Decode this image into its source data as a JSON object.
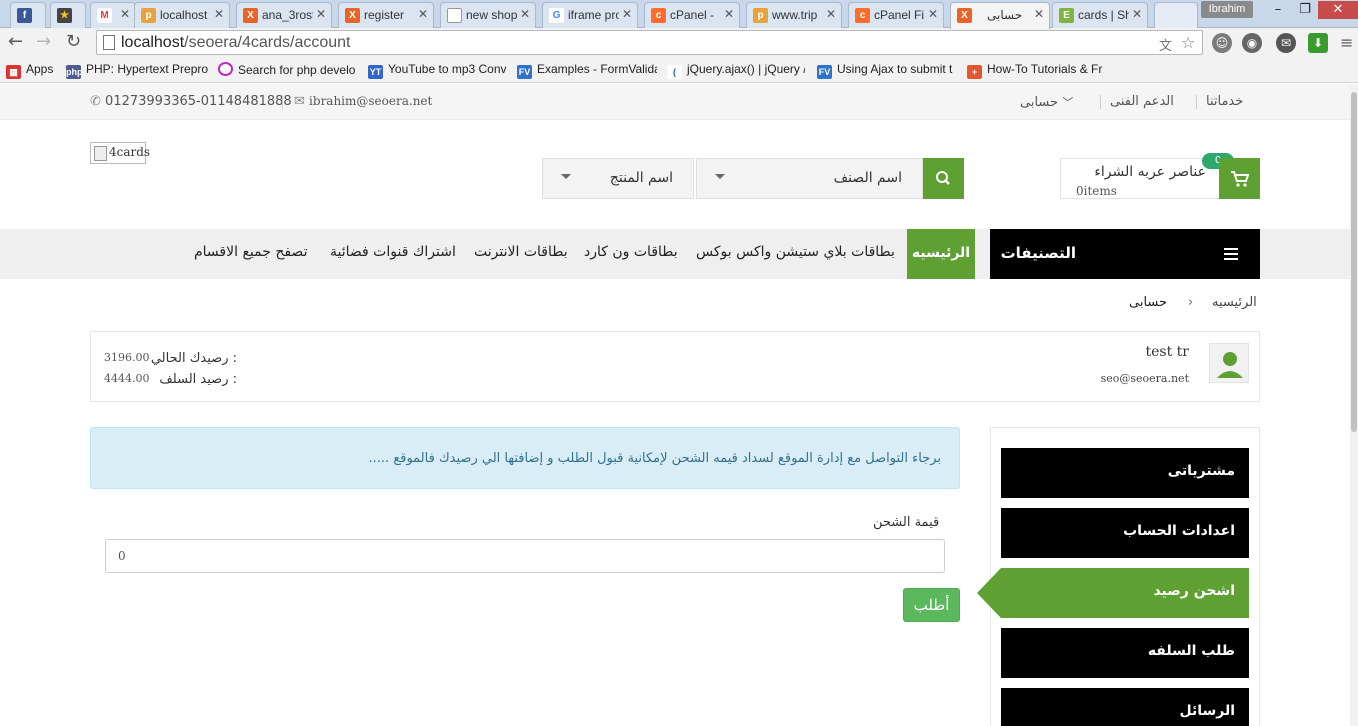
{
  "browser": {
    "tabs": [
      {
        "title": "",
        "icon": "facebook-icon",
        "color": "#3b5998"
      },
      {
        "title": "",
        "icon": "star-icon",
        "color": "#444"
      },
      {
        "title": "",
        "icon": "gmail-icon",
        "color": "#d44638"
      },
      {
        "title": "localhost",
        "icon": "phpmyadmin-icon",
        "color": "#e8a33d"
      },
      {
        "title": "ana_3rost",
        "icon": "xampp-icon",
        "color": "#e8652a"
      },
      {
        "title": "register",
        "icon": "xampp-icon",
        "color": "#e8652a"
      },
      {
        "title": "new shop",
        "icon": "page-icon",
        "color": "#999"
      },
      {
        "title": "iframe pro",
        "icon": "google-icon",
        "color": "#4285f4"
      },
      {
        "title": "cPanel - ",
        "icon": "cpanel-icon",
        "color": "#ff6c2c"
      },
      {
        "title": "www.trip",
        "icon": "phpmyadmin-icon",
        "color": "#e8a33d"
      },
      {
        "title": "cPanel Fi",
        "icon": "cpanel-icon",
        "color": "#ff6c2c"
      },
      {
        "title": "حسابى",
        "icon": "xampp-icon",
        "color": "#e8652a",
        "active": true
      },
      {
        "title": "cards | Sh",
        "icon": "envato-icon",
        "color": "#82b440"
      }
    ],
    "user_chip": "Ibrahim",
    "url_host": "localhost",
    "url_path": "/seoera/4cards/account",
    "bookmarks": [
      {
        "label": "Apps",
        "icon": "apps-icon",
        "color": "#d33"
      },
      {
        "label": "PHP: Hypertext Prepro",
        "icon": "php-icon",
        "color": "#4f5b93"
      },
      {
        "label": "Search for php develo",
        "icon": "search-icon",
        "color": "#c026c0"
      },
      {
        "label": "YouTube to mp3 Conv",
        "icon": "youtube-mp3-icon",
        "color": "#3366cc"
      },
      {
        "label": "Examples - FormValida",
        "icon": "formvalidation-icon",
        "color": "#2e72c9"
      },
      {
        "label": "jQuery.ajax() | jQuery /",
        "icon": "jquery-icon",
        "color": "#0769ad"
      },
      {
        "label": "Using Ajax to submit t",
        "icon": "formvalidation-icon",
        "color": "#2e72c9"
      },
      {
        "label": "How-To Tutorials & Fr",
        "icon": "plus-icon",
        "color": "#e5572f"
      }
    ]
  },
  "topbar": {
    "phone": "01273993365-01148481888",
    "email": "ibrahim@seoera.net",
    "links": [
      "خدماتنا",
      "الدعم الفنى",
      "حسابى"
    ]
  },
  "header": {
    "logo_alt": "4cards",
    "category_select": "اسم الصنف",
    "product_select": "اسم المنتج",
    "cart_title": "عناصر عربه الشراء",
    "cart_items": "0items",
    "cart_count": "0"
  },
  "nav": {
    "categories_label": "التصنيفات",
    "home": "الرئيسيه",
    "links": [
      "بطاقات بلاي ستيشن واكس بوكس",
      "بطاقات ون كارد",
      "بطاقات الانترنت",
      "اشتراك قنوات فضائية",
      "تصفح جميع الاقسام"
    ]
  },
  "breadcrumb": {
    "home": "الرئيسيه",
    "separator": "›",
    "current": "حسابى"
  },
  "profile": {
    "name": "test tr",
    "email": "seo@seoera.net",
    "balance_label": "رصيدك الحالي :",
    "balance": "3196.00",
    "advance_label": "رصيد السلف :",
    "advance": "4444.00"
  },
  "sidebar": {
    "items": [
      {
        "label": "مشترياتى"
      },
      {
        "label": "اعدادات الحساب"
      },
      {
        "label": "اشحن رصيد",
        "active": true
      },
      {
        "label": "طلب السلفه"
      },
      {
        "label": "الرسائل"
      }
    ]
  },
  "alert": {
    "text": "..... برجاء التواصل مع إدارة الموقع لسداد قيمه الشحن لإمكانية قبول الطلب و إضافتها الي رصيدك فالموقع"
  },
  "form": {
    "amount_label": "قيمة الشحن",
    "amount_value": "0",
    "submit_label": "أطلب"
  },
  "colors": {
    "accent": "#5ea032",
    "dark": "#000000",
    "alert_bg": "#d9edf7",
    "alert_text": "#31708f",
    "button_success": "#5cb85c"
  }
}
